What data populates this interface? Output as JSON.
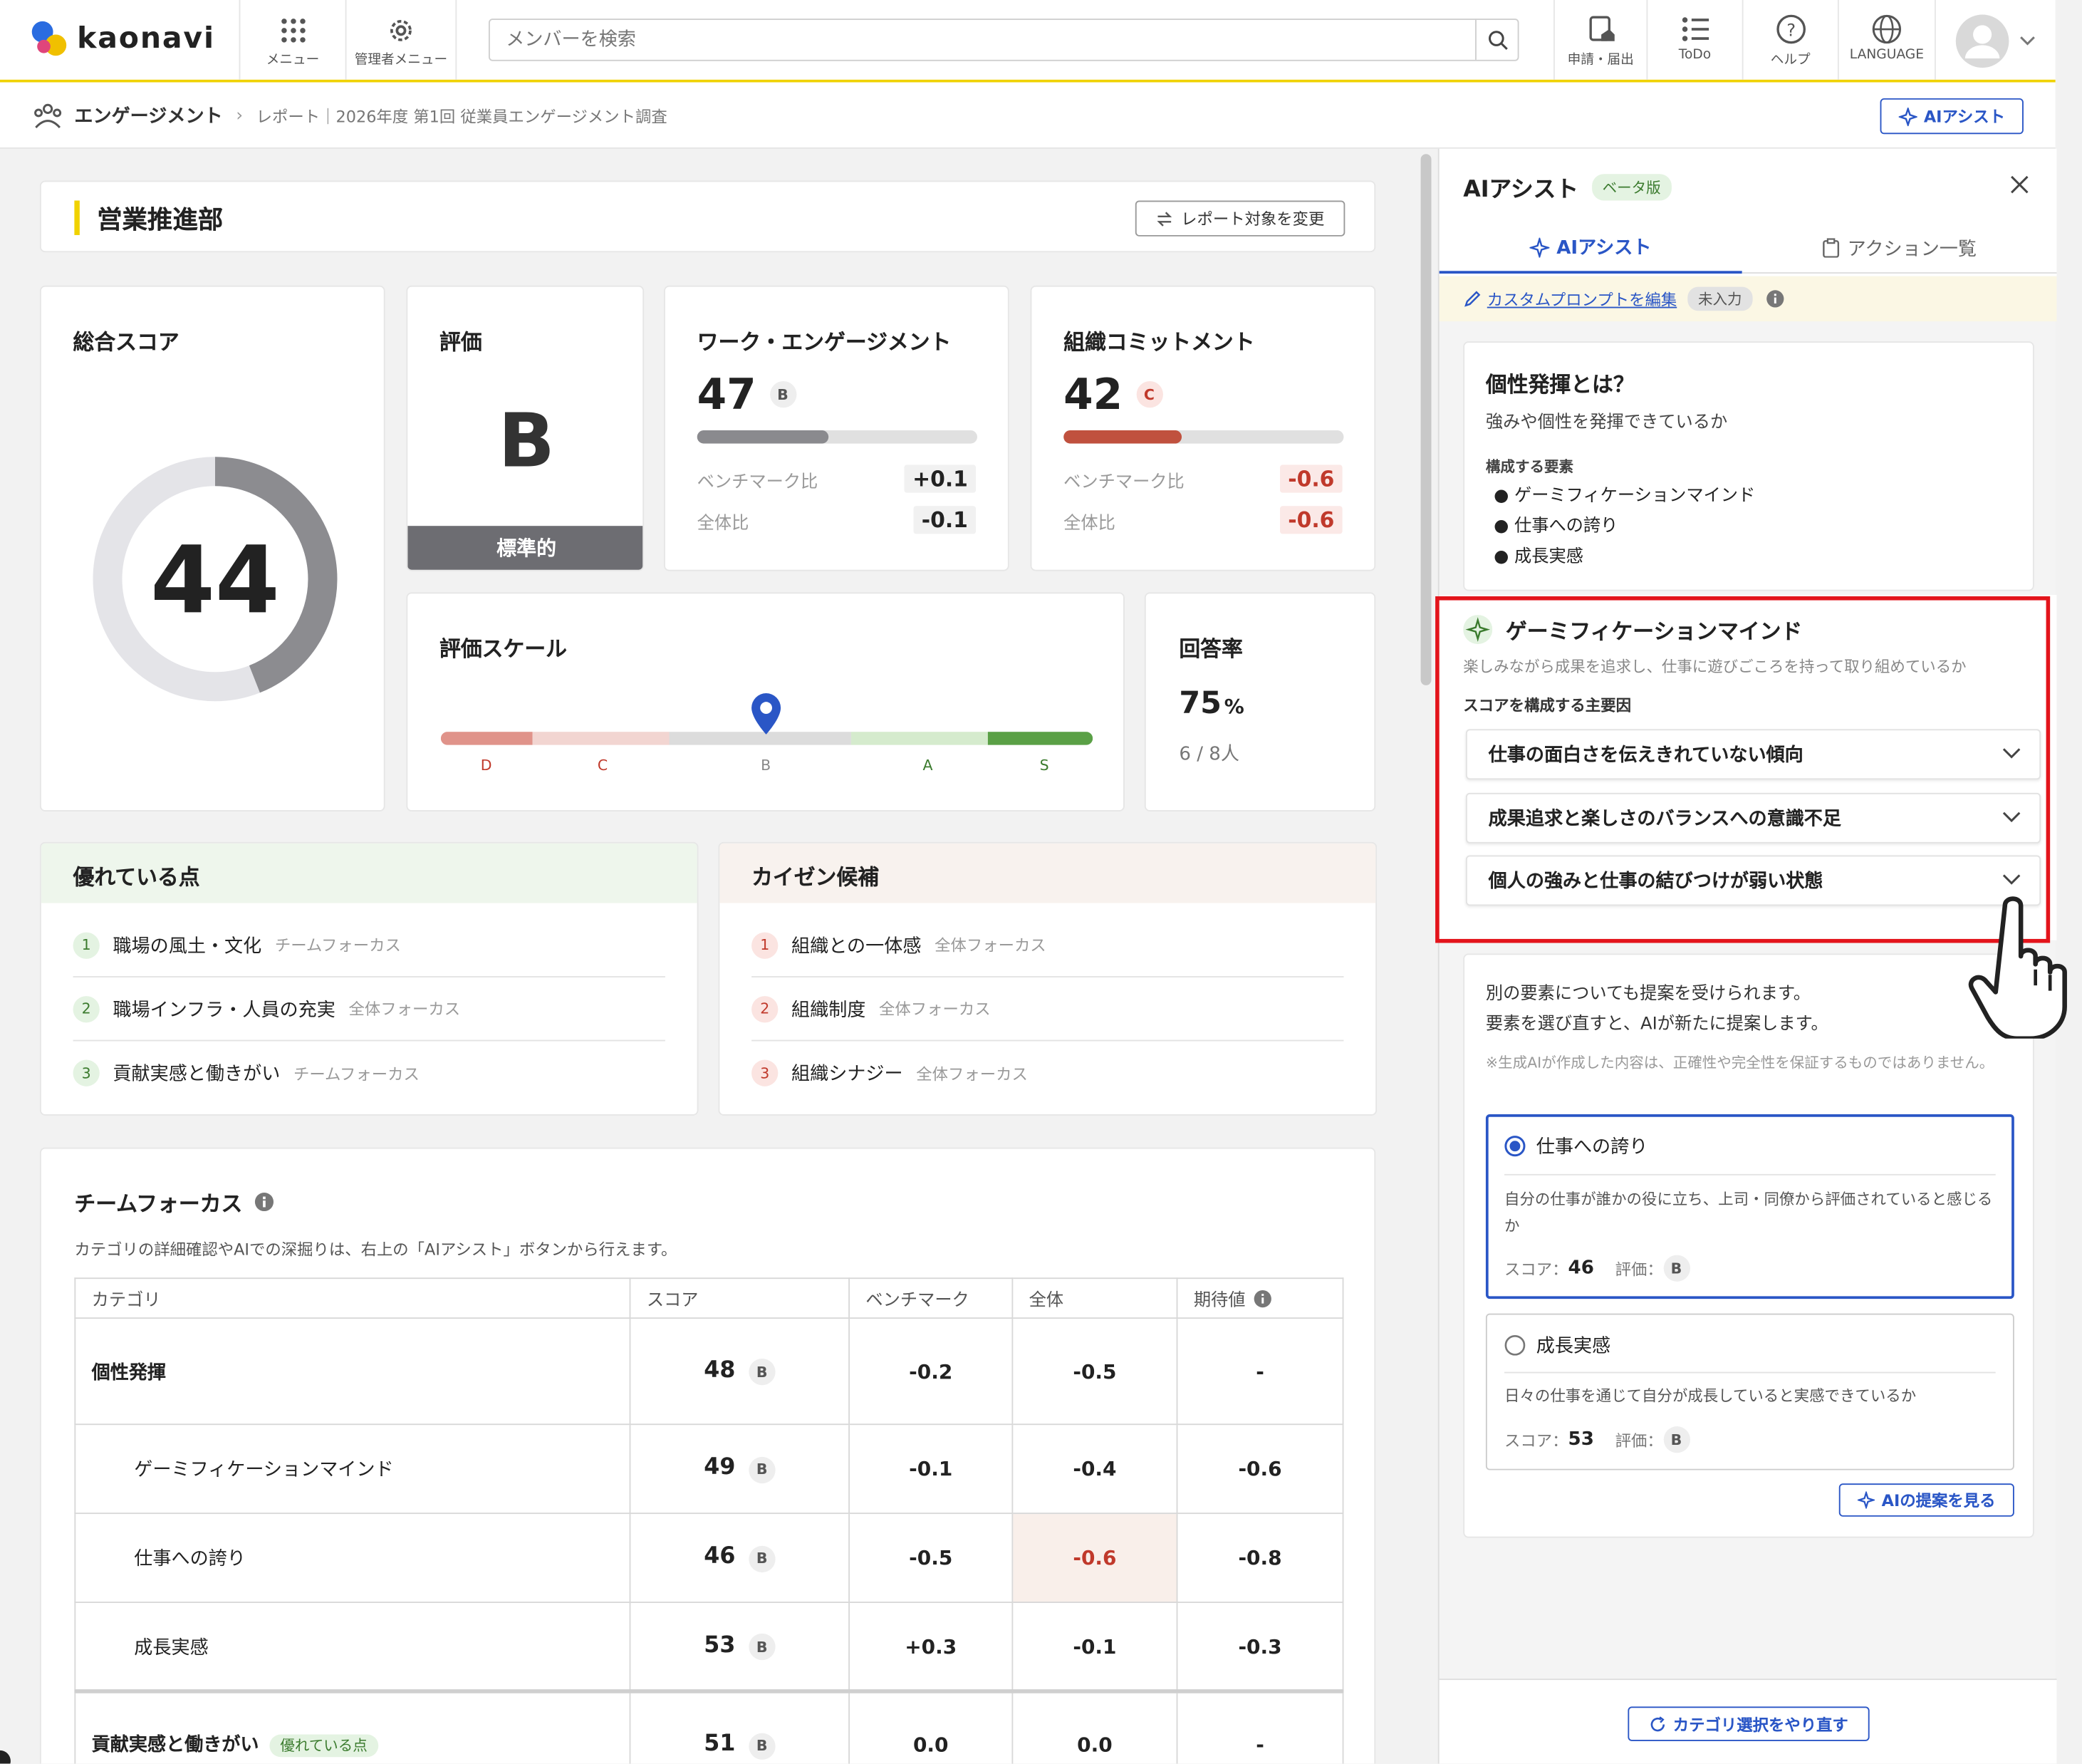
{
  "header": {
    "logo": "kaonavi",
    "menu_label": "メニュー",
    "admin_menu_label": "管理者メニュー",
    "search_placeholder": "メンバーを検索",
    "apply_label": "申請・届出",
    "todo_label": "ToDo",
    "help_label": "ヘルプ",
    "language_label": "LANGUAGE"
  },
  "breadcrumb": {
    "section": "エンゲージメント",
    "path": "レポート｜2026年度 第1回 従業員エンゲージメント調査",
    "ai_button": "AIアシスト"
  },
  "report": {
    "department": "営業推進部",
    "change_target": "レポート対象を変更"
  },
  "total_score": {
    "title": "総合スコア",
    "value": "44",
    "fraction": 0.44
  },
  "rating": {
    "title": "評価",
    "grade": "B",
    "label": "標準的"
  },
  "work_engagement": {
    "title": "ワーク・エンゲージメント",
    "score": "47",
    "grade": "B",
    "progress": 0.47,
    "bench_label": "ベンチマーク比",
    "bench_value": "+0.1",
    "overall_label": "全体比",
    "overall_value": "-0.1"
  },
  "org_commitment": {
    "title": "組織コミットメント",
    "score": "42",
    "grade": "C",
    "progress": 0.42,
    "bench_label": "ベンチマーク比",
    "bench_value": "-0.6",
    "overall_label": "全体比",
    "overall_value": "-0.6"
  },
  "scale": {
    "title": "評価スケール",
    "labels": [
      "D",
      "C",
      "B",
      "A",
      "S"
    ],
    "marker": "B"
  },
  "response_rate": {
    "title": "回答率",
    "value": "75",
    "unit": "%",
    "detail": "6 / 8人"
  },
  "strengths": {
    "title": "優れている点",
    "items": [
      {
        "n": "1",
        "label": "職場の風土・文化",
        "focus": "チームフォーカス"
      },
      {
        "n": "2",
        "label": "職場インフラ・人員の充実",
        "focus": "全体フォーカス"
      },
      {
        "n": "3",
        "label": "貢献実感と働きがい",
        "focus": "チームフォーカス"
      }
    ]
  },
  "improvements": {
    "title": "カイゼン候補",
    "items": [
      {
        "n": "1",
        "label": "組織との一体感",
        "focus": "全体フォーカス"
      },
      {
        "n": "2",
        "label": "組織制度",
        "focus": "全体フォーカス"
      },
      {
        "n": "3",
        "label": "組織シナジー",
        "focus": "全体フォーカス"
      }
    ]
  },
  "team_focus": {
    "title": "チームフォーカス",
    "description": "カテゴリの詳細確認やAIでの深掘りは、右上の「AIアシスト」ボタンから行えます。",
    "columns": [
      "カテゴリ",
      "スコア",
      "ベンチマーク",
      "全体",
      "期待値"
    ],
    "rows": [
      {
        "category": "個性発揮",
        "score": "48",
        "grade": "B",
        "bench": "-0.2",
        "overall": "-0.5",
        "expected": "-"
      },
      {
        "category": "ゲーミフィケーションマインド",
        "score": "49",
        "grade": "B",
        "bench": "-0.1",
        "overall": "-0.4",
        "expected": "-0.6"
      },
      {
        "category": "仕事への誇り",
        "score": "46",
        "grade": "B",
        "bench": "-0.5",
        "overall": "-0.6",
        "expected": "-0.8"
      },
      {
        "category": "成長実感",
        "score": "53",
        "grade": "B",
        "bench": "+0.3",
        "overall": "-0.1",
        "expected": "-0.3"
      },
      {
        "category": "貢献実感と働きがい",
        "tag": "優れている点",
        "score": "51",
        "grade": "B",
        "bench": "0.0",
        "overall": "0.0",
        "expected": "-"
      }
    ]
  },
  "ai_panel": {
    "title": "AIアシスト",
    "beta": "ベータ版",
    "tab_ai": "AIアシスト",
    "tab_actions": "アクション一覧",
    "custom_prompt": "カスタムプロンプトを編集",
    "custom_status": "未入力",
    "about_title": "個性発揮とは？",
    "about_desc": "強みや個性を発揮できているか",
    "components_label": "構成する要素",
    "components": [
      "ゲーミフィケーションマインド",
      "仕事への誇り",
      "成長実感"
    ],
    "gm_title": "ゲーミフィケーションマインド",
    "gm_desc": "楽しみながら成果を追求し、仕事に遊びごころを持って取り組めているか",
    "factors_label": "スコアを構成する主要因",
    "factors": [
      "仕事の面白さを伝えきれていない傾向",
      "成果追求と楽しさのバランスへの意識不足",
      "個人の強みと仕事の結びつけが弱い状態"
    ],
    "suggest_line1": "別の要素についても提案を受けられます。",
    "suggest_line2": "要素を選び直すと、AIが新たに提案します。",
    "disclaimer": "※生成AIが作成した内容は、正確性や完全性を保証するものではありません。",
    "options": [
      {
        "name": "仕事への誇り",
        "desc": "自分の仕事が誰かの役に立ち、上司・同僚から評価されていると感じるか",
        "score_label": "スコア：",
        "score": "46",
        "grade_label": "評価：",
        "grade": "B"
      },
      {
        "name": "成長実感",
        "desc": "日々の仕事を通じて自分が成長していると実感できているか",
        "score_label": "スコア：",
        "score": "53",
        "grade_label": "評価：",
        "grade": "B"
      }
    ],
    "see_suggestion": "AIの提案を見る",
    "redo": "カテゴリ選択をやり直す"
  },
  "colors": {
    "accent": "#f0d200",
    "blue": "#2a56c6",
    "red": "#c0392b",
    "green": "#5aa046"
  }
}
